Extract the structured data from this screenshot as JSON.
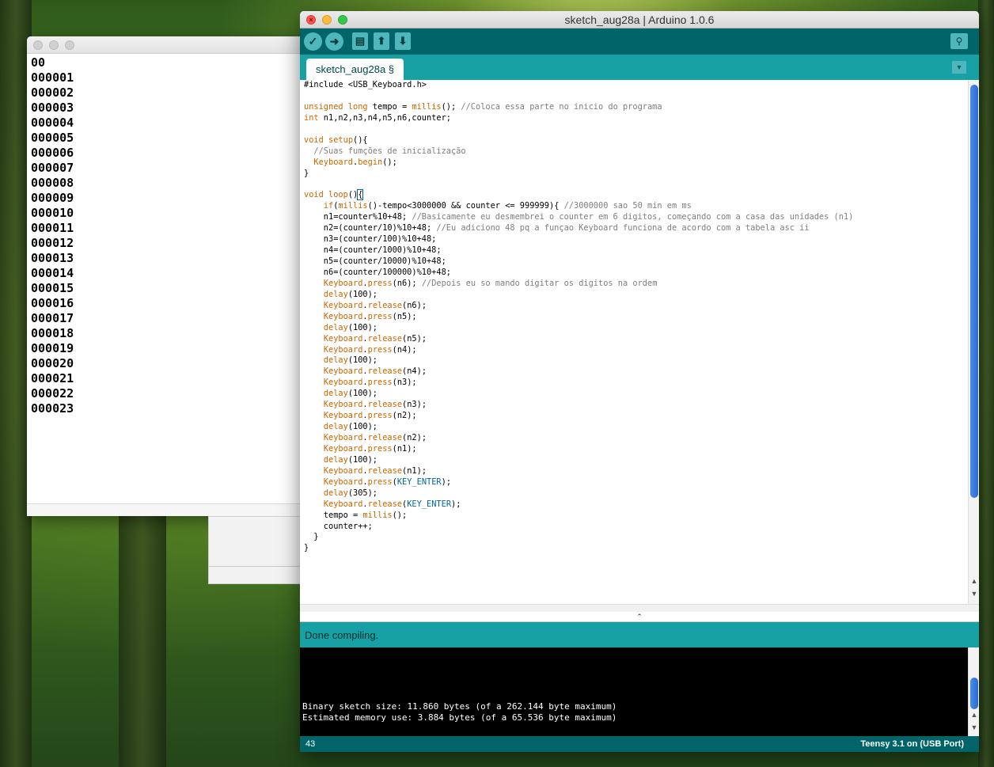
{
  "serial": {
    "lines": [
      "00",
      "000001",
      "000002",
      "000003",
      "000004",
      "000005",
      "000006",
      "000007",
      "000008",
      "000009",
      "000010",
      "000011",
      "000012",
      "000013",
      "000014",
      "000015",
      "000016",
      "000017",
      "000018",
      "000019",
      "000020",
      "000021",
      "000022",
      "000023"
    ]
  },
  "ide": {
    "title": "sketch_aug28a | Arduino 1.0.6",
    "tab_label": "sketch_aug28a §",
    "status_message": "Done compiling.",
    "console_lines": [
      "Binary sketch size: 11.860 bytes (of a 262.144 byte maximum)",
      "Estimated memory use: 3.884 bytes (of a 65.536 byte maximum)"
    ],
    "footer": {
      "line_number": "43",
      "board": "Teensy 3.1 on (USB Port)"
    },
    "toolbar": {
      "verify_icon": "check-icon",
      "upload_icon": "arrow-right-icon",
      "new_icon": "new-file-icon",
      "open_icon": "arrow-up-icon",
      "save_icon": "arrow-down-icon",
      "serial_icon": "magnifier-icon"
    },
    "colors": {
      "toolbar": "#006468",
      "tabbar": "#17a1a5",
      "keyword": "#cc6600",
      "comment": "#7e7e7e",
      "constant": "#006699"
    },
    "code_lines": [
      [
        [
          "",
          "#include <USB_Keyboard.h>"
        ]
      ],
      [],
      [
        [
          "kw",
          "unsigned long"
        ],
        [
          "",
          " tempo = "
        ],
        [
          "kw",
          "millis"
        ],
        [
          "",
          "(); "
        ],
        [
          "cm",
          "//Coloca essa parte no inicio do programa"
        ]
      ],
      [
        [
          "kw",
          "int"
        ],
        [
          "",
          " n1,n2,n3,n4,n5,n6,counter;"
        ]
      ],
      [],
      [
        [
          "kw",
          "void"
        ],
        [
          "",
          " "
        ],
        [
          "kw",
          "setup"
        ],
        [
          "",
          "(){"
        ]
      ],
      [
        [
          "",
          "  "
        ],
        [
          "cm",
          "//Suas fumções de inicialização"
        ]
      ],
      [
        [
          "",
          "  "
        ],
        [
          "kw",
          "Keyboard"
        ],
        [
          "",
          "."
        ],
        [
          "kw",
          "begin"
        ],
        [
          "",
          "();"
        ]
      ],
      [
        [
          "",
          "}"
        ]
      ],
      [],
      [
        [
          "kw",
          "void"
        ],
        [
          "",
          " "
        ],
        [
          "kw",
          "loop"
        ],
        [
          "",
          "()"
        ],
        [
          "cur",
          "{"
        ]
      ],
      [
        [
          "",
          "    "
        ],
        [
          "kw",
          "if"
        ],
        [
          "",
          "("
        ],
        [
          "kw",
          "millis"
        ],
        [
          "",
          "()-tempo<3000000 && counter <= 999999){ "
        ],
        [
          "cm",
          "//3000000 sao 50 min em ms"
        ]
      ],
      [
        [
          "",
          "    n1=counter%10+48; "
        ],
        [
          "cm",
          "//Basicamente eu desmembrei o counter em 6 digitos, começando com a casa das unidades (n1)"
        ]
      ],
      [
        [
          "",
          "    n2=(counter/10)%10+48; "
        ],
        [
          "cm",
          "//Eu adiciono 48 pq a funçao Keyboard funciona de acordo com a tabela asc ii"
        ]
      ],
      [
        [
          "",
          "    n3=(counter/100)%10+48;"
        ]
      ],
      [
        [
          "",
          "    n4=(counter/1000)%10+48;"
        ]
      ],
      [
        [
          "",
          "    n5=(counter/10000)%10+48;"
        ]
      ],
      [
        [
          "",
          "    n6=(counter/100000)%10+48;"
        ]
      ],
      [
        [
          "",
          "    "
        ],
        [
          "kw",
          "Keyboard"
        ],
        [
          "",
          "."
        ],
        [
          "kw",
          "press"
        ],
        [
          "",
          "(n6); "
        ],
        [
          "cm",
          "//Depois eu so mando digitar os digitos na ordem"
        ]
      ],
      [
        [
          "",
          "    "
        ],
        [
          "kw",
          "delay"
        ],
        [
          "",
          "(100);"
        ]
      ],
      [
        [
          "",
          "    "
        ],
        [
          "kw",
          "Keyboard"
        ],
        [
          "",
          "."
        ],
        [
          "kw",
          "release"
        ],
        [
          "",
          "(n6);"
        ]
      ],
      [
        [
          "",
          "    "
        ],
        [
          "kw",
          "Keyboard"
        ],
        [
          "",
          "."
        ],
        [
          "kw",
          "press"
        ],
        [
          "",
          "(n5);"
        ]
      ],
      [
        [
          "",
          "    "
        ],
        [
          "kw",
          "delay"
        ],
        [
          "",
          "(100);"
        ]
      ],
      [
        [
          "",
          "    "
        ],
        [
          "kw",
          "Keyboard"
        ],
        [
          "",
          "."
        ],
        [
          "kw",
          "release"
        ],
        [
          "",
          "(n5);"
        ]
      ],
      [
        [
          "",
          "    "
        ],
        [
          "kw",
          "Keyboard"
        ],
        [
          "",
          "."
        ],
        [
          "kw",
          "press"
        ],
        [
          "",
          "(n4);"
        ]
      ],
      [
        [
          "",
          "    "
        ],
        [
          "kw",
          "delay"
        ],
        [
          "",
          "(100);"
        ]
      ],
      [
        [
          "",
          "    "
        ],
        [
          "kw",
          "Keyboard"
        ],
        [
          "",
          "."
        ],
        [
          "kw",
          "release"
        ],
        [
          "",
          "(n4);"
        ]
      ],
      [
        [
          "",
          "    "
        ],
        [
          "kw",
          "Keyboard"
        ],
        [
          "",
          "."
        ],
        [
          "kw",
          "press"
        ],
        [
          "",
          "(n3);"
        ]
      ],
      [
        [
          "",
          "    "
        ],
        [
          "kw",
          "delay"
        ],
        [
          "",
          "(100);"
        ]
      ],
      [
        [
          "",
          "    "
        ],
        [
          "kw",
          "Keyboard"
        ],
        [
          "",
          "."
        ],
        [
          "kw",
          "release"
        ],
        [
          "",
          "(n3);"
        ]
      ],
      [
        [
          "",
          "    "
        ],
        [
          "kw",
          "Keyboard"
        ],
        [
          "",
          "."
        ],
        [
          "kw",
          "press"
        ],
        [
          "",
          "(n2);"
        ]
      ],
      [
        [
          "",
          "    "
        ],
        [
          "kw",
          "delay"
        ],
        [
          "",
          "(100);"
        ]
      ],
      [
        [
          "",
          "    "
        ],
        [
          "kw",
          "Keyboard"
        ],
        [
          "",
          "."
        ],
        [
          "kw",
          "release"
        ],
        [
          "",
          "(n2);"
        ]
      ],
      [
        [
          "",
          "    "
        ],
        [
          "kw",
          "Keyboard"
        ],
        [
          "",
          "."
        ],
        [
          "kw",
          "press"
        ],
        [
          "",
          "(n1);"
        ]
      ],
      [
        [
          "",
          "    "
        ],
        [
          "kw",
          "delay"
        ],
        [
          "",
          "(100);"
        ]
      ],
      [
        [
          "",
          "    "
        ],
        [
          "kw",
          "Keyboard"
        ],
        [
          "",
          "."
        ],
        [
          "kw",
          "release"
        ],
        [
          "",
          "(n1);"
        ]
      ],
      [
        [
          "",
          "    "
        ],
        [
          "kw",
          "Keyboard"
        ],
        [
          "",
          "."
        ],
        [
          "kw",
          "press"
        ],
        [
          "",
          "("
        ],
        [
          "cn",
          "KEY_ENTER"
        ],
        [
          "",
          ");"
        ]
      ],
      [
        [
          "",
          "    "
        ],
        [
          "kw",
          "delay"
        ],
        [
          "",
          "(305);"
        ]
      ],
      [
        [
          "",
          "    "
        ],
        [
          "kw",
          "Keyboard"
        ],
        [
          "",
          "."
        ],
        [
          "kw",
          "release"
        ],
        [
          "",
          "("
        ],
        [
          "cn",
          "KEY_ENTER"
        ],
        [
          "",
          ");"
        ]
      ],
      [
        [
          "",
          "    tempo = "
        ],
        [
          "kw",
          "millis"
        ],
        [
          "",
          "();"
        ]
      ],
      [
        [
          "",
          "    counter++;"
        ]
      ],
      [
        [
          "",
          "  }"
        ]
      ],
      [
        [
          "",
          "}"
        ]
      ]
    ]
  }
}
